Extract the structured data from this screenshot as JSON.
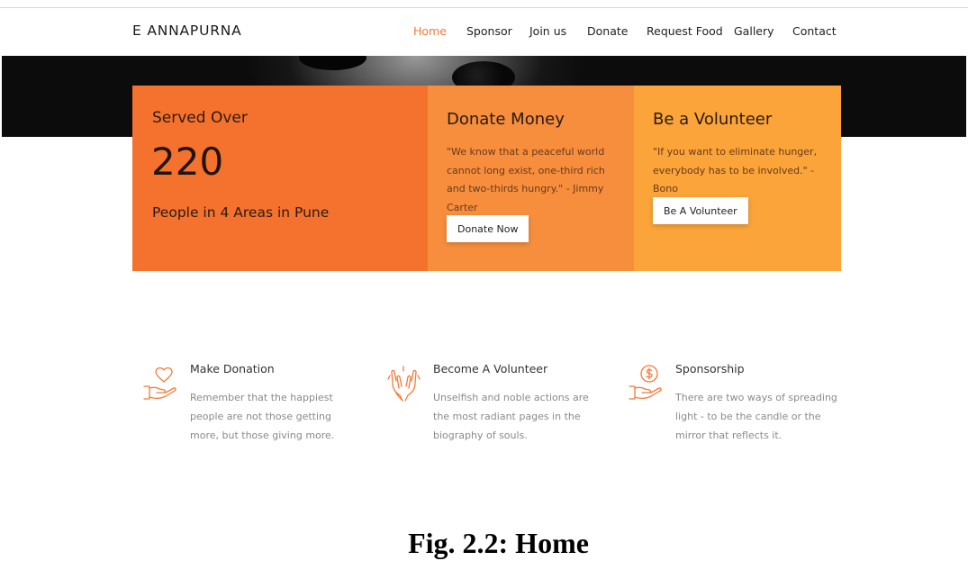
{
  "brand": "E ANNAPURNA",
  "nav": [
    {
      "label": "Home",
      "active": true
    },
    {
      "label": "Sponsor"
    },
    {
      "label": "Join us"
    },
    {
      "label": "Donate"
    },
    {
      "label": "Request Food"
    },
    {
      "label": "Gallery"
    },
    {
      "label": "Contact"
    }
  ],
  "stats": {
    "heading": "Served Over",
    "count": "220",
    "subtext": "People in 4 Areas in Pune"
  },
  "donate": {
    "title": "Donate Money",
    "quote": "\"We know that a peaceful world cannot long exist, one-third rich and two-thirds hungry.\" - Jimmy Carter",
    "button": "Donate Now"
  },
  "volunteer": {
    "title": "Be a Volunteer",
    "quote": "\"If you want to eliminate hunger, everybody has to be involved.\" - Bono",
    "button": "Be A Volunteer"
  },
  "features": [
    {
      "icon": "heart-hand-icon",
      "title": "Make Donation",
      "text": "Remember that the happiest people are not those getting more, but those giving more."
    },
    {
      "icon": "praying-hands-icon",
      "title": "Become A Volunteer",
      "text": "Unselfish and noble actions are the most radiant pages in the biography of souls."
    },
    {
      "icon": "coin-hand-icon",
      "title": "Sponsorship",
      "text": "There are two ways of spreading light - to be the candle or the mirror that reflects it."
    }
  ],
  "caption": "Fig. 2.2: Home",
  "colors": {
    "accent": "#f47a3a",
    "card1": "#f5722e",
    "card2": "#f68e3d",
    "card3": "#faa43a"
  }
}
